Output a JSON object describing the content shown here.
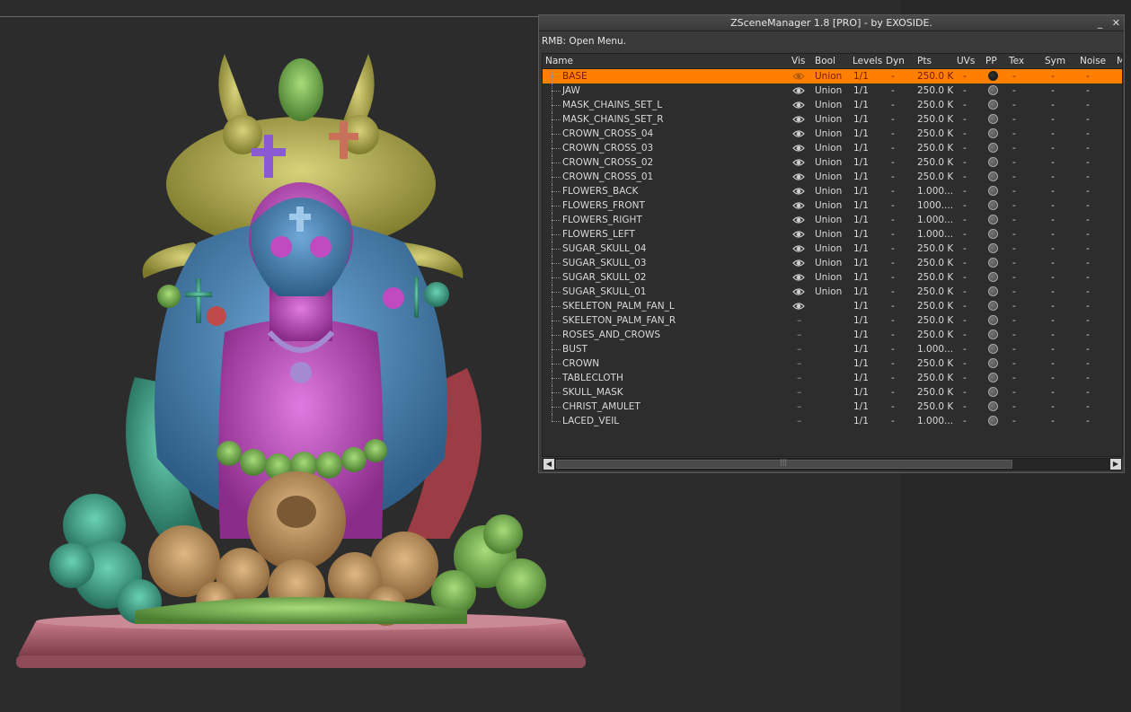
{
  "window": {
    "title": "ZSceneManager 1.8 [PRO]  - by EXOSIDE.",
    "minimize_glyph": "_",
    "close_glyph": "✕",
    "hint": "RMB: Open Menu."
  },
  "table": {
    "columns": [
      "Name",
      "Vis",
      "Bool",
      "Levels",
      "Dyn",
      "Pts",
      "UVs",
      "PP",
      "Tex",
      "Sym",
      "Noise",
      "M"
    ],
    "rows": [
      {
        "name": "BASE",
        "vis": true,
        "bool": "Union",
        "levels": "1/1",
        "dyn": "-",
        "pts": "250.0 K",
        "uvs": "-",
        "tex": "-",
        "sym": "-",
        "noise": "-",
        "selected": true
      },
      {
        "name": "JAW",
        "vis": true,
        "bool": "Union",
        "levels": "1/1",
        "dyn": "-",
        "pts": "250.0 K",
        "uvs": "-",
        "tex": "-",
        "sym": "-",
        "noise": "-"
      },
      {
        "name": "MASK_CHAINS_SET_L",
        "vis": true,
        "bool": "Union",
        "levels": "1/1",
        "dyn": "-",
        "pts": "250.0 K",
        "uvs": "-",
        "tex": "-",
        "sym": "-",
        "noise": "-"
      },
      {
        "name": "MASK_CHAINS_SET_R",
        "vis": true,
        "bool": "Union",
        "levels": "1/1",
        "dyn": "-",
        "pts": "250.0 K",
        "uvs": "-",
        "tex": "-",
        "sym": "-",
        "noise": "-"
      },
      {
        "name": "CROWN_CROSS_04",
        "vis": true,
        "bool": "Union",
        "levels": "1/1",
        "dyn": "-",
        "pts": "250.0 K",
        "uvs": "-",
        "tex": "-",
        "sym": "-",
        "noise": "-"
      },
      {
        "name": "CROWN_CROSS_03",
        "vis": true,
        "bool": "Union",
        "levels": "1/1",
        "dyn": "-",
        "pts": "250.0 K",
        "uvs": "-",
        "tex": "-",
        "sym": "-",
        "noise": "-"
      },
      {
        "name": "CROWN_CROSS_02",
        "vis": true,
        "bool": "Union",
        "levels": "1/1",
        "dyn": "-",
        "pts": "250.0 K",
        "uvs": "-",
        "tex": "-",
        "sym": "-",
        "noise": "-"
      },
      {
        "name": "CROWN_CROSS_01",
        "vis": true,
        "bool": "Union",
        "levels": "1/1",
        "dyn": "-",
        "pts": "250.0 K",
        "uvs": "-",
        "tex": "-",
        "sym": "-",
        "noise": "-"
      },
      {
        "name": "FLOWERS_BACK",
        "vis": true,
        "bool": "Union",
        "levels": "1/1",
        "dyn": "-",
        "pts": "1.000...",
        "uvs": "-",
        "tex": "-",
        "sym": "-",
        "noise": "-"
      },
      {
        "name": "FLOWERS_FRONT",
        "vis": true,
        "bool": "Union",
        "levels": "1/1",
        "dyn": "-",
        "pts": "1000....",
        "uvs": "-",
        "tex": "-",
        "sym": "-",
        "noise": "-"
      },
      {
        "name": "FLOWERS_RIGHT",
        "vis": true,
        "bool": "Union",
        "levels": "1/1",
        "dyn": "-",
        "pts": "1.000...",
        "uvs": "-",
        "tex": "-",
        "sym": "-",
        "noise": "-"
      },
      {
        "name": "FLOWERS_LEFT",
        "vis": true,
        "bool": "Union",
        "levels": "1/1",
        "dyn": "-",
        "pts": "1.000...",
        "uvs": "-",
        "tex": "-",
        "sym": "-",
        "noise": "-"
      },
      {
        "name": "SUGAR_SKULL_04",
        "vis": true,
        "bool": "Union",
        "levels": "1/1",
        "dyn": "-",
        "pts": "250.0 K",
        "uvs": "-",
        "tex": "-",
        "sym": "-",
        "noise": "-"
      },
      {
        "name": "SUGAR_SKULL_03",
        "vis": true,
        "bool": "Union",
        "levels": "1/1",
        "dyn": "-",
        "pts": "250.0 K",
        "uvs": "-",
        "tex": "-",
        "sym": "-",
        "noise": "-"
      },
      {
        "name": "SUGAR_SKULL_02",
        "vis": true,
        "bool": "Union",
        "levels": "1/1",
        "dyn": "-",
        "pts": "250.0 K",
        "uvs": "-",
        "tex": "-",
        "sym": "-",
        "noise": "-"
      },
      {
        "name": "SUGAR_SKULL_01",
        "vis": true,
        "bool": "Union",
        "levels": "1/1",
        "dyn": "-",
        "pts": "250.0 K",
        "uvs": "-",
        "tex": "-",
        "sym": "-",
        "noise": "-"
      },
      {
        "name": "SKELETON_PALM_FAN_L",
        "vis": true,
        "bool": "",
        "levels": "1/1",
        "dyn": "-",
        "pts": "250.0 K",
        "uvs": "-",
        "tex": "-",
        "sym": "-",
        "noise": "-"
      },
      {
        "name": "SKELETON_PALM_FAN_R",
        "vis": false,
        "bool": "",
        "levels": "1/1",
        "dyn": "-",
        "pts": "250.0 K",
        "uvs": "-",
        "tex": "-",
        "sym": "-",
        "noise": "-"
      },
      {
        "name": "ROSES_AND_CROWS",
        "vis": false,
        "bool": "",
        "levels": "1/1",
        "dyn": "-",
        "pts": "250.0 K",
        "uvs": "-",
        "tex": "-",
        "sym": "-",
        "noise": "-"
      },
      {
        "name": "BUST",
        "vis": false,
        "bool": "",
        "levels": "1/1",
        "dyn": "-",
        "pts": "1.000...",
        "uvs": "-",
        "tex": "-",
        "sym": "-",
        "noise": "-"
      },
      {
        "name": "CROWN",
        "vis": false,
        "bool": "",
        "levels": "1/1",
        "dyn": "-",
        "pts": "250.0 K",
        "uvs": "-",
        "tex": "-",
        "sym": "-",
        "noise": "-"
      },
      {
        "name": "TABLECLOTH",
        "vis": false,
        "bool": "",
        "levels": "1/1",
        "dyn": "-",
        "pts": "250.0 K",
        "uvs": "-",
        "tex": "-",
        "sym": "-",
        "noise": "-"
      },
      {
        "name": "SKULL_MASK",
        "vis": false,
        "bool": "",
        "levels": "1/1",
        "dyn": "-",
        "pts": "250.0 K",
        "uvs": "-",
        "tex": "-",
        "sym": "-",
        "noise": "-"
      },
      {
        "name": "CHRIST_AMULET",
        "vis": false,
        "bool": "",
        "levels": "1/1",
        "dyn": "-",
        "pts": "250.0 K",
        "uvs": "-",
        "tex": "-",
        "sym": "-",
        "noise": "-"
      },
      {
        "name": "LACED_VEIL",
        "vis": false,
        "bool": "",
        "levels": "1/1",
        "dyn": "-",
        "pts": "1.000...",
        "uvs": "-",
        "tex": "-",
        "sym": "-",
        "noise": "-"
      }
    ],
    "hidden_glyph": "–",
    "scroll_left_glyph": "◀",
    "scroll_right_glyph": "▶",
    "scroll_thumb_glyph": "|||"
  },
  "colors": {
    "selection": "#ff8000",
    "selection_text": "#7a1616",
    "panel_bg": "#393939"
  }
}
